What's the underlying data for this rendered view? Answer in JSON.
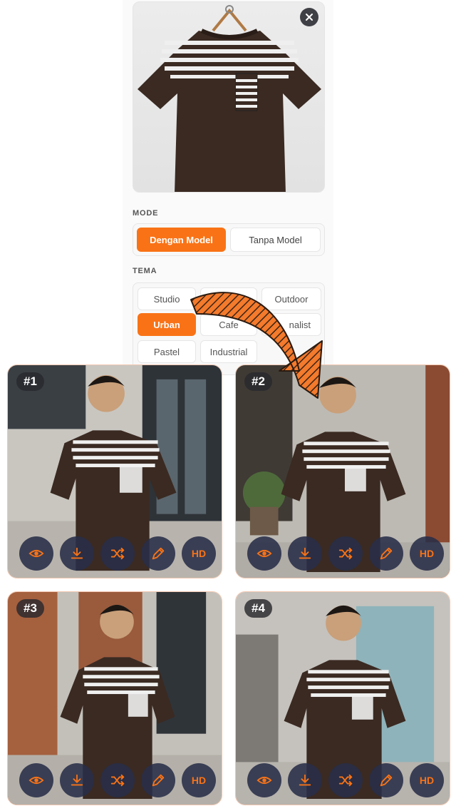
{
  "upload": {
    "close_icon": "close-icon"
  },
  "mode": {
    "label": "MODE",
    "options": [
      "Dengan Model",
      "Tanpa Model"
    ],
    "selected": "Dengan Model"
  },
  "tema": {
    "label": "TEMA",
    "options": [
      "Studio",
      "Urban",
      "Cafe",
      "Minimalist",
      "Outdoor",
      "Pastel",
      "Industrial"
    ],
    "visible_text": {
      "cafe": "Cafe",
      "minimalist": "nalist"
    },
    "selected": "Urban"
  },
  "colors": {
    "accent": "#f97316",
    "action_bg": "#282e48"
  },
  "results": [
    {
      "badge": "#1",
      "actions": [
        "eye-icon",
        "download-icon",
        "shuffle-icon",
        "pencil-icon",
        "HD"
      ]
    },
    {
      "badge": "#2",
      "actions": [
        "eye-icon",
        "download-icon",
        "shuffle-icon",
        "pencil-icon",
        "HD"
      ]
    },
    {
      "badge": "#3",
      "actions": [
        "eye-icon",
        "download-icon",
        "shuffle-icon",
        "pencil-icon",
        "HD"
      ]
    },
    {
      "badge": "#4",
      "actions": [
        "eye-icon",
        "download-icon",
        "shuffle-icon",
        "pencil-icon",
        "HD"
      ]
    }
  ],
  "hd_label": "HD"
}
